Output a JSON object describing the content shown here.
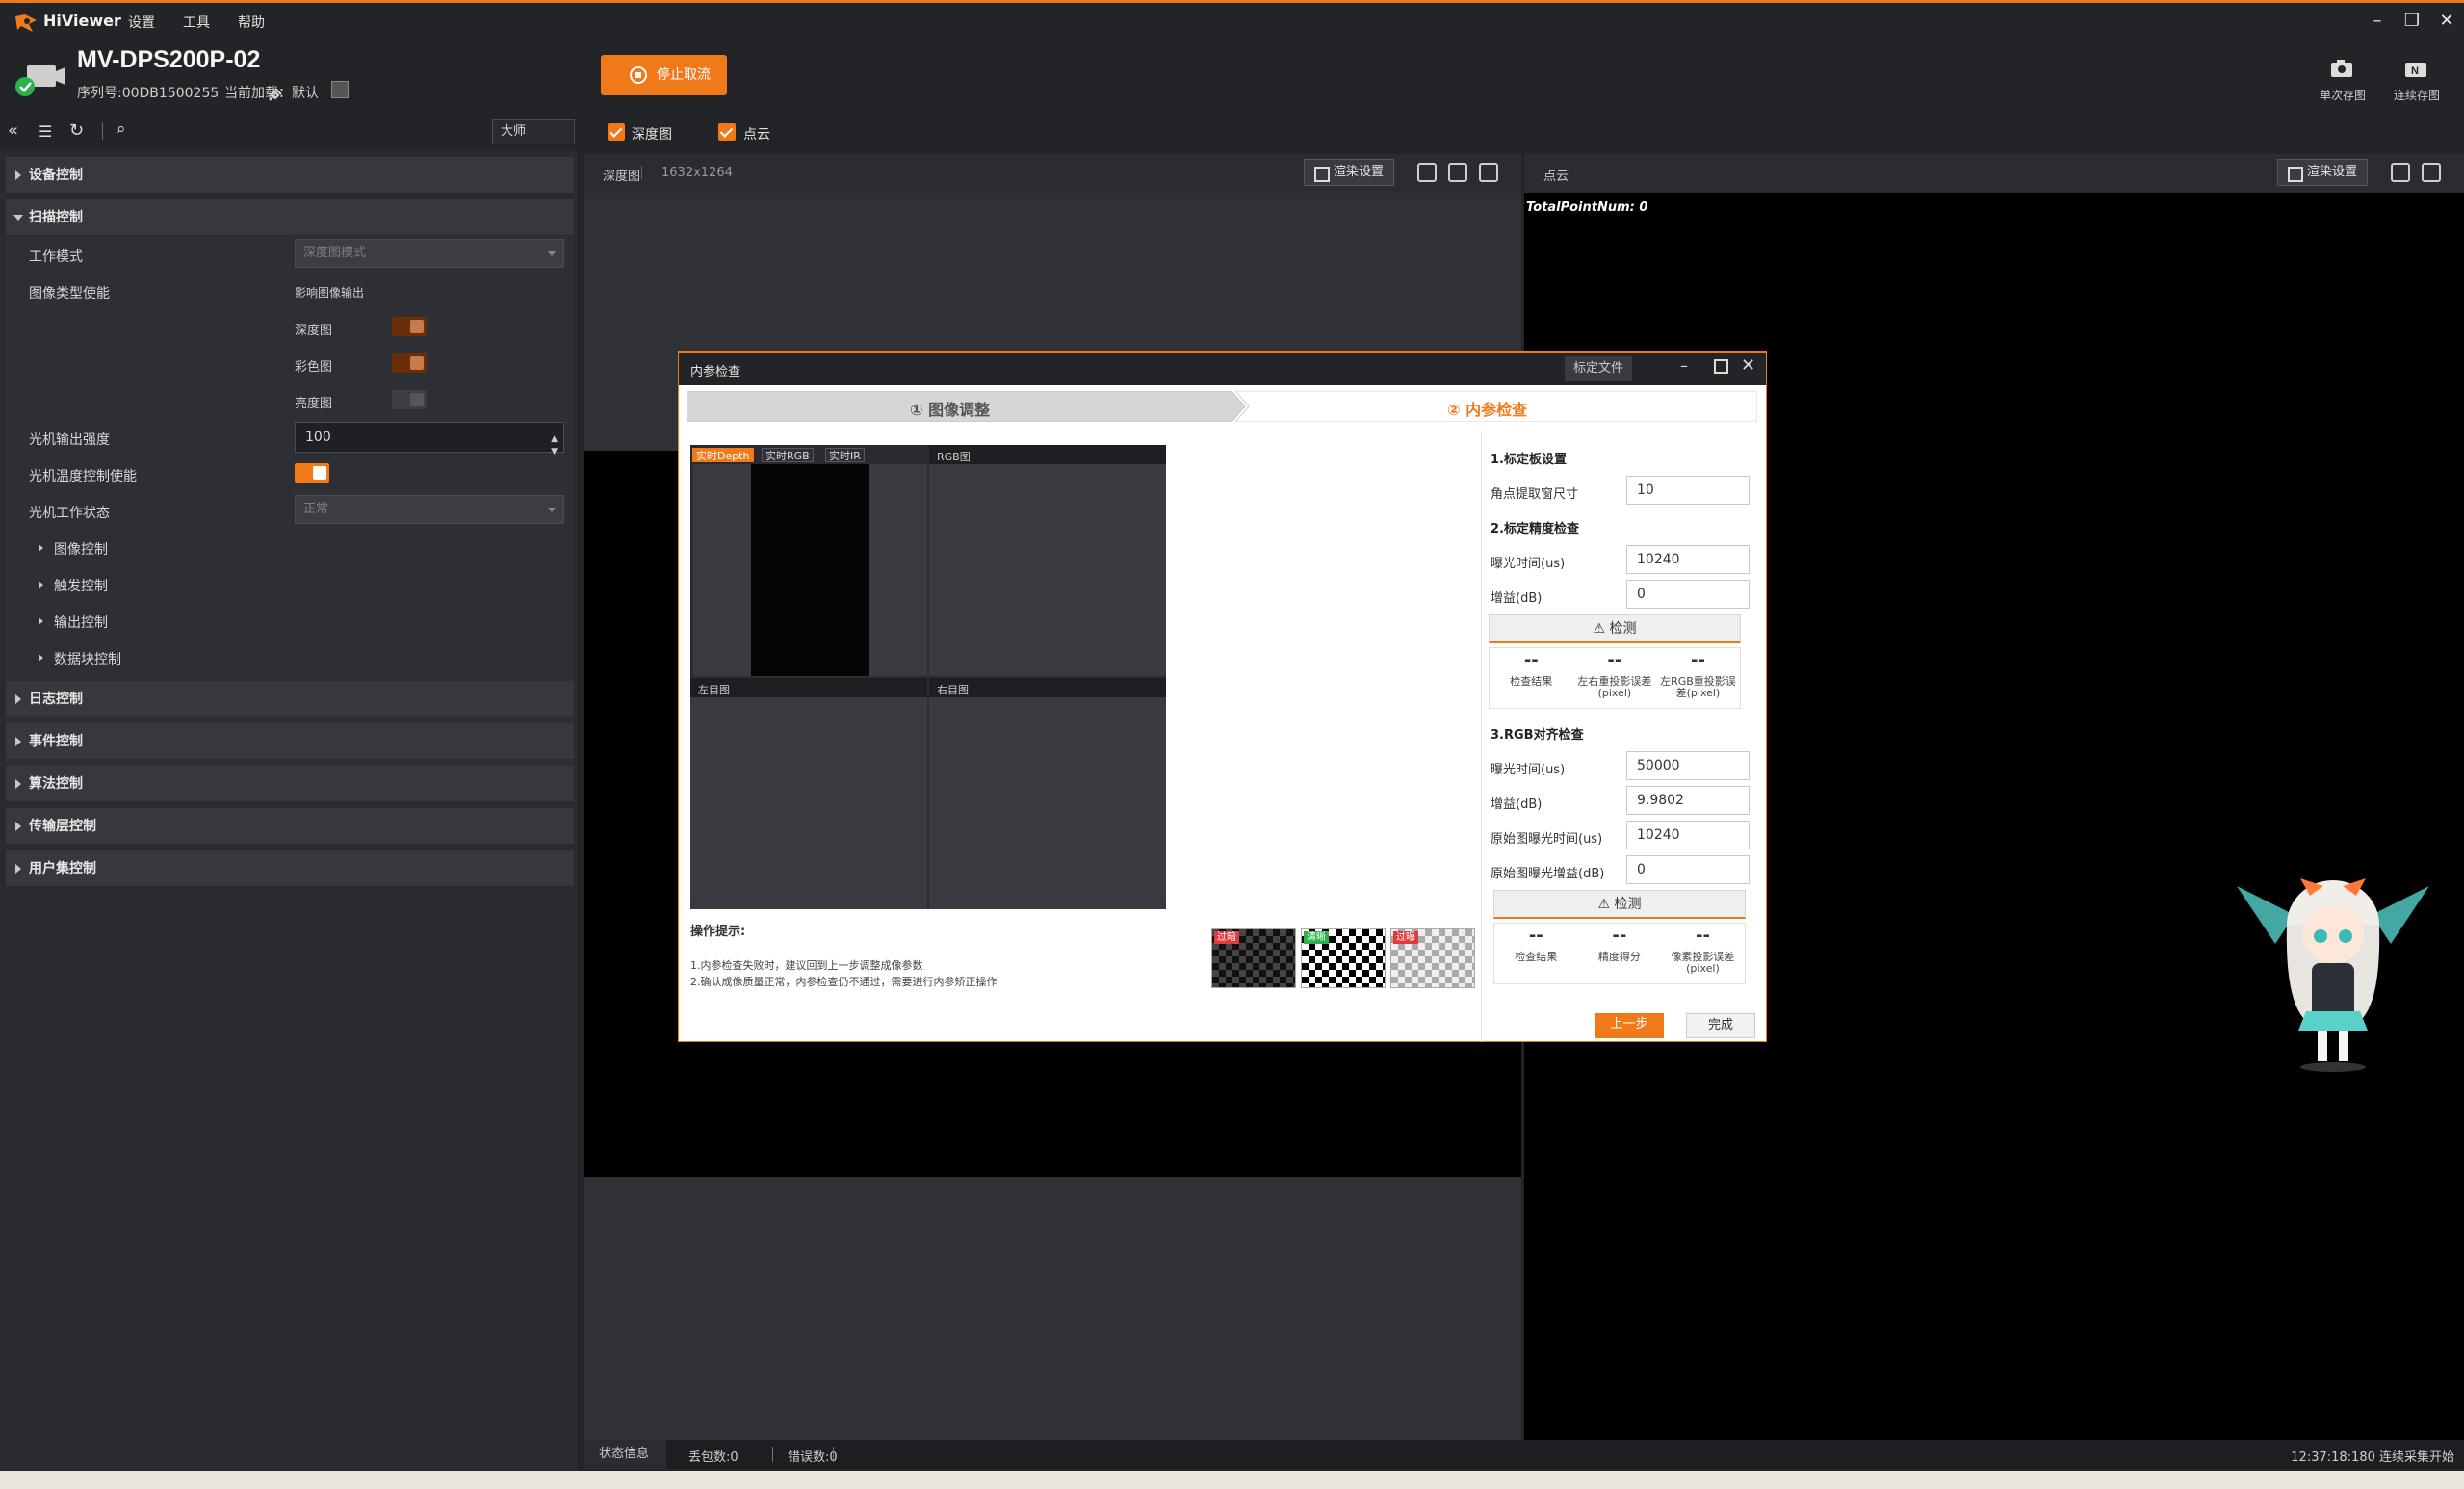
{
  "app": {
    "name": "HiViewer",
    "menu": [
      "设置",
      "工具",
      "帮助"
    ]
  },
  "device": {
    "name": "MV-DPS200P-02",
    "serial": "序列号:00DB1500255",
    "loaded": "当前加载：默认",
    "stop_label": "停止取流",
    "single_capture": "单次存图",
    "continuous_capture": "连续存图"
  },
  "left": {
    "level": "大师",
    "sections": {
      "device_control": "设备控制",
      "scan_control": "扫描控制",
      "log_control": "日志控制",
      "event_control": "事件控制",
      "algo_control": "算法控制",
      "transport_control": "传输层控制",
      "userset_control": "用户集控制"
    },
    "scan": {
      "work_mode_label": "工作模式",
      "work_mode_value": "深度图模式",
      "image_type_label": "图像类型使能",
      "image_output_label": "影响图像输出",
      "depth_label": "深度图",
      "color_label": "彩色图",
      "bright_label": "亮度图",
      "light_intensity_label": "光机输出强度",
      "light_intensity_value": "100",
      "temp_control_label": "光机温度控制使能",
      "light_status_label": "光机工作状态",
      "light_status_value": "正常",
      "subsections": [
        "图像控制",
        "触发控制",
        "输出控制",
        "数据块控制"
      ]
    }
  },
  "view": {
    "depth_check_label": "深度图",
    "cloud_check_label": "点云",
    "depth_pane_title": "深度图",
    "depth_pane_res": "1632x1264",
    "render_settings": "渲染设置",
    "cloud_pane_title": "点云",
    "total_points": "TotalPointNum: 0"
  },
  "dialog": {
    "title": "内参检查",
    "calib_file": "标定文件",
    "step1": "① 图像调整",
    "step2": "② 内参检查",
    "chips": [
      "实时Depth",
      "实时RGB",
      "实时IR"
    ],
    "quad_labels": {
      "rgb": "RGB图",
      "left": "左目图",
      "right": "右目图"
    },
    "tips_title": "操作提示:",
    "tip1": "1.内参检查失败时，建议回到上一步调整成像参数",
    "tip2": "2.确认成像质量正常，内参检查仍不通过，需要进行内参矫正操作",
    "thumb_tags": [
      "过暗",
      "清晰",
      "过曝"
    ],
    "sec1_title": "1.标定板设置",
    "corner_label": "角点提取窗尺寸",
    "corner_value": "10",
    "sec2_title": "2.标定精度检查",
    "exp_label": "曝光时间(us)",
    "exp_value": "10240",
    "gain_label": "增益(dB)",
    "gain_value": "0",
    "detect_label": "检测",
    "res_dash": "--",
    "res1_cap": [
      "检查结果",
      "左右重投影误差(pixel)",
      "左RGB重投影误差(pixel)"
    ],
    "sec3_title": "3.RGB对齐检查",
    "rgb_exp_label": "曝光时间(us)",
    "rgb_exp_value": "50000",
    "rgb_gain_label": "增益(dB)",
    "rgb_gain_value": "9.9802",
    "orig_exp_label": "原始图曝光时间(us)",
    "orig_exp_value": "10240",
    "orig_gain_label": "原始图曝光增益(dB)",
    "orig_gain_value": "0",
    "res2_cap": [
      "检查结果",
      "精度得分",
      "像素投影误差(pixel)"
    ],
    "prev_label": "上一步",
    "done_label": "完成"
  },
  "status": {
    "tab": "状态信息",
    "lost": "丢包数:0",
    "err": "错误数:0",
    "right": "12:37:18:180 连续采集开始"
  },
  "colors": {
    "accent": "#f07a1a",
    "bg": "#232428",
    "panel": "#2a2b30"
  }
}
